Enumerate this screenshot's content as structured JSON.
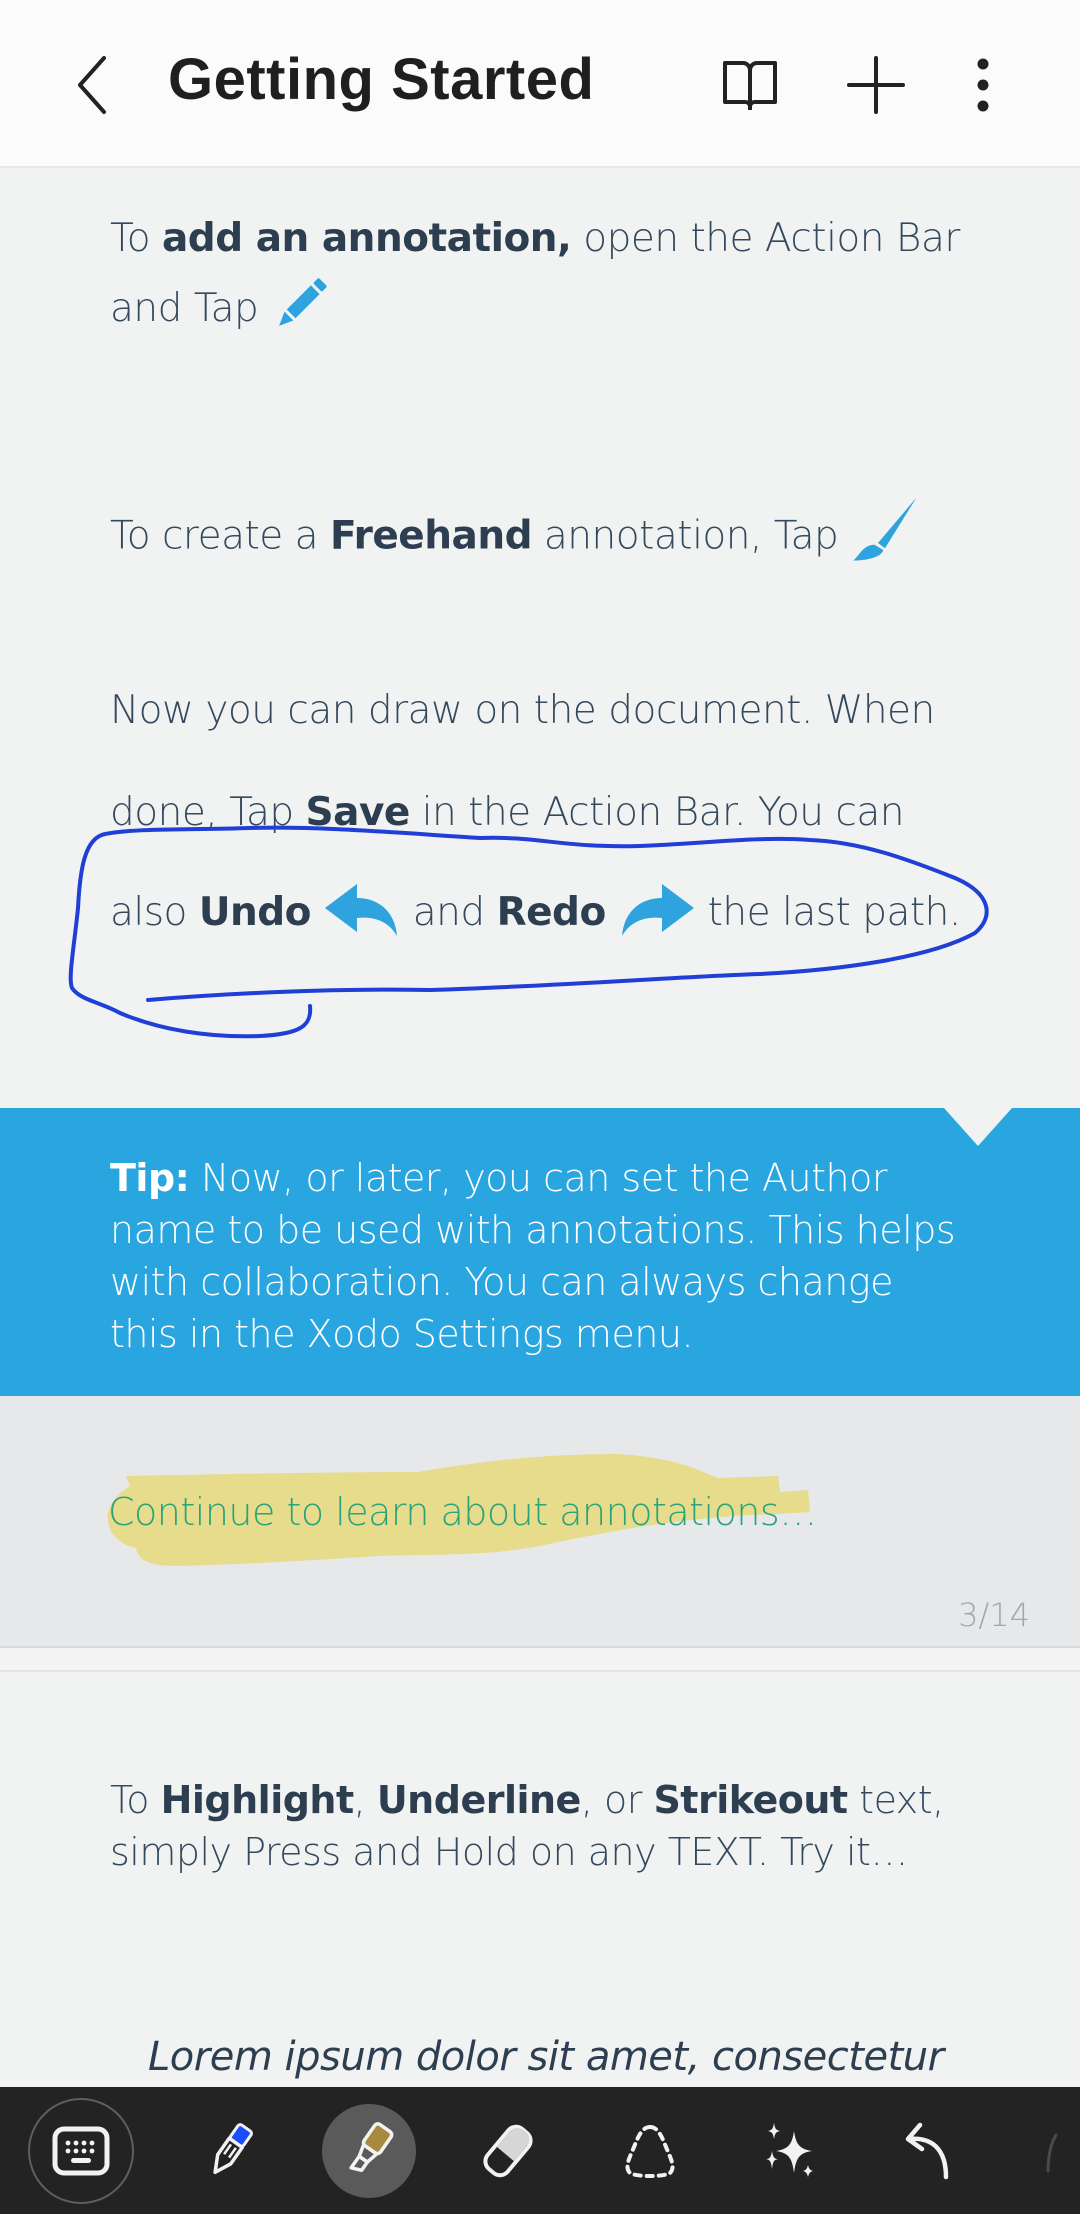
{
  "appbar": {
    "title": "Getting Started",
    "icons": [
      "back-chevron-icon",
      "book-view-icon",
      "add-icon",
      "more-vertical-icon"
    ]
  },
  "document": {
    "para1": {
      "prefix": "To ",
      "bold": "add an annotation,",
      "suffix": " open the Action Bar",
      "line2": "and Tap ",
      "icon": "pencil-icon"
    },
    "para2": {
      "prefix": "To create a ",
      "bold": "Freehand",
      "suffix": " annotation, Tap ",
      "icon": "brush-icon"
    },
    "para3": {
      "line1": "Now you can draw on the document. When",
      "line2_prefix": "done, Tap ",
      "line2_bold": "Save",
      "line2_suffix": " in the Action Bar. You can",
      "line3_prefix": "also ",
      "line3_undo": "Undo",
      "line3_mid": " and ",
      "line3_redo": "Redo",
      "line3_suffix": " the last path."
    },
    "tip": {
      "label": "Tip:",
      "text": " Now, or later, you can set the Author name to be used with annotations. This helps with collaboration. You can always change this in the Xodo Settings menu."
    },
    "continue_link": "Continue to learn about annotations…",
    "page_indicator": "3/14",
    "para4": {
      "prefix": "To ",
      "b1": "Highlight",
      "sep1": ", ",
      "b2": "Underline",
      "sep2": ", or ",
      "b3": "Strikeout",
      "suffix": " text,",
      "line2": "simply Press and Hold on any TEXT. Try it…"
    },
    "lorem": "Lorem ipsum dolor sit amet, consectetur"
  },
  "colors": {
    "accent_blue": "#29a6df",
    "freehand_ink": "#1f3fd6",
    "highlight_ink": "#e6dc8c",
    "link_green": "#2aa27a",
    "body_text": "#34495e",
    "toolbar_bg": "#232323"
  },
  "toolbar": {
    "tools": [
      {
        "name": "keyboard",
        "icon": "keyboard-icon",
        "active": false
      },
      {
        "name": "pen",
        "icon": "pen-icon",
        "active": false
      },
      {
        "name": "highlighter",
        "icon": "highlighter-icon",
        "active": true
      },
      {
        "name": "eraser",
        "icon": "eraser-icon",
        "active": false
      },
      {
        "name": "lasso",
        "icon": "lasso-select-icon",
        "active": false
      },
      {
        "name": "ai-assist",
        "icon": "sparkle-icon",
        "active": false
      },
      {
        "name": "undo",
        "icon": "undo-icon",
        "active": false
      }
    ]
  }
}
